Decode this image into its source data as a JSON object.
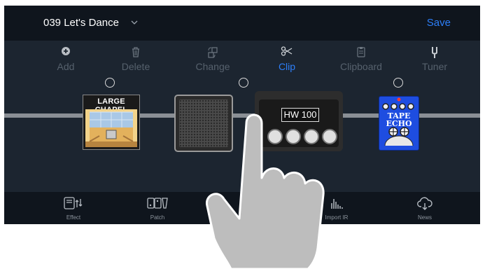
{
  "header": {
    "patch_name": "039 Let's Dance",
    "save_label": "Save"
  },
  "toolbar": {
    "items": [
      {
        "label": "Add",
        "icon": "plus-circle-icon"
      },
      {
        "label": "Delete",
        "icon": "trash-icon"
      },
      {
        "label": "Change",
        "icon": "swap-icon"
      },
      {
        "label": "Clip",
        "icon": "scissors-icon",
        "active": true
      },
      {
        "label": "Clipboard",
        "icon": "clipboard-icon"
      },
      {
        "label": "Tuner",
        "icon": "tuning-fork-icon"
      }
    ]
  },
  "chain": {
    "blocks": [
      {
        "type": "reverb",
        "label": "LARGE CHAPEL"
      },
      {
        "type": "cabinet"
      },
      {
        "type": "amp",
        "label": "HW 100"
      },
      {
        "type": "delay",
        "label_line1": "TAPE",
        "label_line2": "ECHO"
      }
    ]
  },
  "bottom_nav": {
    "items": [
      {
        "label": "Effect",
        "icon": "effect-icon"
      },
      {
        "label": "Patch",
        "icon": "patch-icon"
      },
      {
        "label": "Import IR",
        "icon": "import-ir-icon"
      },
      {
        "label": "News",
        "icon": "cloud-download-icon"
      }
    ]
  },
  "colors": {
    "accent": "#2d7ff9",
    "background": "#1c2530",
    "bar": "#0f151d",
    "inactive": "#56616d"
  }
}
